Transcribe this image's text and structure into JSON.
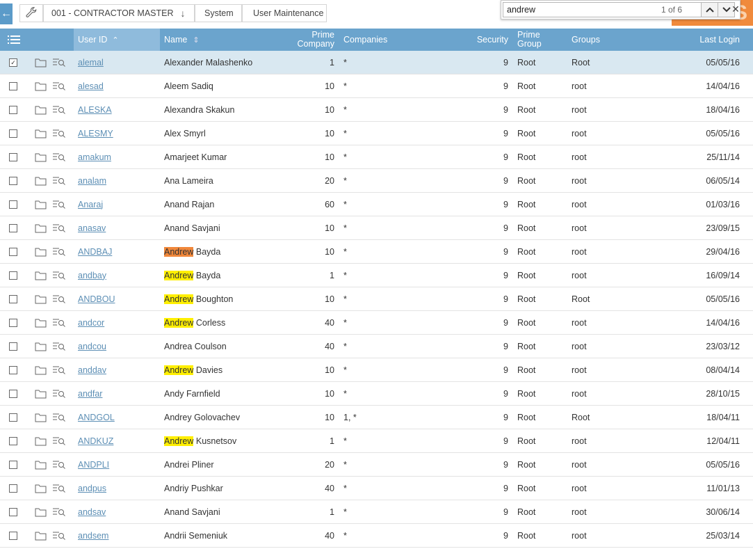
{
  "breadcrumb": {
    "company": "001 - CONTRACTOR MASTER",
    "system": "System",
    "page": "User Maintenance"
  },
  "find": {
    "query": "andrew",
    "count": "1 of 6"
  },
  "columns": {
    "user_id": "User ID",
    "name": "Name",
    "prime_company": [
      "Prime",
      "Company"
    ],
    "companies": "Companies",
    "security": "Security",
    "prime_group": [
      "Prime",
      "Group"
    ],
    "groups": "Groups",
    "last_login": "Last Login"
  },
  "colors": {
    "header_bg": "#6ba4cd",
    "sorted_header_bg": "#8fbbdc",
    "selected_row": "#d9e8f1",
    "link": "#5d8fb5",
    "highlight": "#ffef00",
    "active_highlight": "#f0873a",
    "accent_orange": "#f08a3c"
  },
  "icons": [
    "back-arrow-icon",
    "wrench-icon",
    "chevron-down-icon",
    "chevron-up-icon",
    "close-icon",
    "list-menu-icon",
    "folder-icon",
    "view-detail-icon",
    "sort-asc-icon",
    "sort-icon",
    "checkbox-icon"
  ],
  "rows": [
    {
      "checked": true,
      "user_id": "alemal",
      "highlight": "",
      "name_rest": "Alexander Malashenko",
      "prime": "1",
      "companies": "*",
      "security": "9",
      "prime_group": "Root",
      "groups": "Root",
      "last_login": "05/05/16"
    },
    {
      "checked": false,
      "user_id": "alesad",
      "highlight": "",
      "name_rest": "Aleem Sadiq",
      "prime": "10",
      "companies": "*",
      "security": "9",
      "prime_group": "Root",
      "groups": "root",
      "last_login": "14/04/16"
    },
    {
      "checked": false,
      "user_id": "ALESKA",
      "highlight": "",
      "name_rest": "Alexandra Skakun",
      "prime": "10",
      "companies": "*",
      "security": "9",
      "prime_group": "Root",
      "groups": "root",
      "last_login": "18/04/16"
    },
    {
      "checked": false,
      "user_id": "ALESMY",
      "highlight": "",
      "name_rest": "Alex Smyrl",
      "prime": "10",
      "companies": "*",
      "security": "9",
      "prime_group": "Root",
      "groups": "root",
      "last_login": "05/05/16"
    },
    {
      "checked": false,
      "user_id": "amakum",
      "highlight": "",
      "name_rest": "Amarjeet Kumar",
      "prime": "10",
      "companies": "*",
      "security": "9",
      "prime_group": "Root",
      "groups": "root",
      "last_login": "25/11/14"
    },
    {
      "checked": false,
      "user_id": "analam",
      "highlight": "",
      "name_rest": "Ana Lameira",
      "prime": "20",
      "companies": "*",
      "security": "9",
      "prime_group": "Root",
      "groups": "root",
      "last_login": "06/05/14"
    },
    {
      "checked": false,
      "user_id": "Anaraj",
      "highlight": "",
      "name_rest": "Anand Rajan",
      "prime": "60",
      "companies": "*",
      "security": "9",
      "prime_group": "Root",
      "groups": "root",
      "last_login": "01/03/16"
    },
    {
      "checked": false,
      "user_id": "anasav",
      "highlight": "",
      "name_rest": "Anand Savjani",
      "prime": "10",
      "companies": "*",
      "security": "9",
      "prime_group": "Root",
      "groups": "root",
      "last_login": "23/09/15"
    },
    {
      "checked": false,
      "user_id": "ANDBAJ",
      "highlight": "Andrew",
      "active": true,
      "name_rest": " Bayda",
      "prime": "10",
      "companies": "*",
      "security": "9",
      "prime_group": "Root",
      "groups": "root",
      "last_login": "29/04/16"
    },
    {
      "checked": false,
      "user_id": "andbay",
      "highlight": "Andrew",
      "name_rest": " Bayda",
      "prime": "1",
      "companies": "*",
      "security": "9",
      "prime_group": "Root",
      "groups": "root",
      "last_login": "16/09/14"
    },
    {
      "checked": false,
      "user_id": "ANDBOU",
      "highlight": "Andrew",
      "name_rest": " Boughton",
      "prime": "10",
      "companies": "*",
      "security": "9",
      "prime_group": "Root",
      "groups": "Root",
      "last_login": "05/05/16"
    },
    {
      "checked": false,
      "user_id": "andcor",
      "highlight": "Andrew",
      "name_rest": " Corless",
      "prime": "40",
      "companies": "*",
      "security": "9",
      "prime_group": "Root",
      "groups": "root",
      "last_login": "14/04/16"
    },
    {
      "checked": false,
      "user_id": "andcou",
      "highlight": "",
      "name_rest": "Andrea Coulson",
      "prime": "40",
      "companies": "*",
      "security": "9",
      "prime_group": "Root",
      "groups": "root",
      "last_login": "23/03/12"
    },
    {
      "checked": false,
      "user_id": "anddav",
      "highlight": "Andrew",
      "name_rest": " Davies",
      "prime": "10",
      "companies": "*",
      "security": "9",
      "prime_group": "Root",
      "groups": "root",
      "last_login": "08/04/14"
    },
    {
      "checked": false,
      "user_id": "andfar",
      "highlight": "",
      "name_rest": "Andy Farnfield",
      "prime": "10",
      "companies": "*",
      "security": "9",
      "prime_group": "Root",
      "groups": "root",
      "last_login": "28/10/15"
    },
    {
      "checked": false,
      "user_id": "ANDGOL",
      "highlight": "",
      "name_rest": "Andrey Golovachev",
      "prime": "10",
      "companies": "1, *",
      "security": "9",
      "prime_group": "Root",
      "groups": "Root",
      "last_login": "18/04/11"
    },
    {
      "checked": false,
      "user_id": "ANDKUZ",
      "highlight": "Andrew",
      "name_rest": " Kusnetsov",
      "prime": "1",
      "companies": "*",
      "security": "9",
      "prime_group": "Root",
      "groups": "root",
      "last_login": "12/04/11"
    },
    {
      "checked": false,
      "user_id": "ANDPLI",
      "highlight": "",
      "name_rest": "Andrei Pliner",
      "prime": "20",
      "companies": "*",
      "security": "9",
      "prime_group": "Root",
      "groups": "root",
      "last_login": "05/05/16"
    },
    {
      "checked": false,
      "user_id": "andpus",
      "highlight": "",
      "name_rest": "Andriy Pushkar",
      "prime": "40",
      "companies": "*",
      "security": "9",
      "prime_group": "Root",
      "groups": "root",
      "last_login": "11/01/13"
    },
    {
      "checked": false,
      "user_id": "andsav",
      "highlight": "",
      "name_rest": "Anand Savjani",
      "prime": "1",
      "companies": "*",
      "security": "9",
      "prime_group": "Root",
      "groups": "root",
      "last_login": "30/06/14"
    },
    {
      "checked": false,
      "user_id": "andsem",
      "highlight": "",
      "name_rest": "Andrii Semeniuk",
      "prime": "40",
      "companies": "*",
      "security": "9",
      "prime_group": "Root",
      "groups": "root",
      "last_login": "25/03/14"
    }
  ]
}
